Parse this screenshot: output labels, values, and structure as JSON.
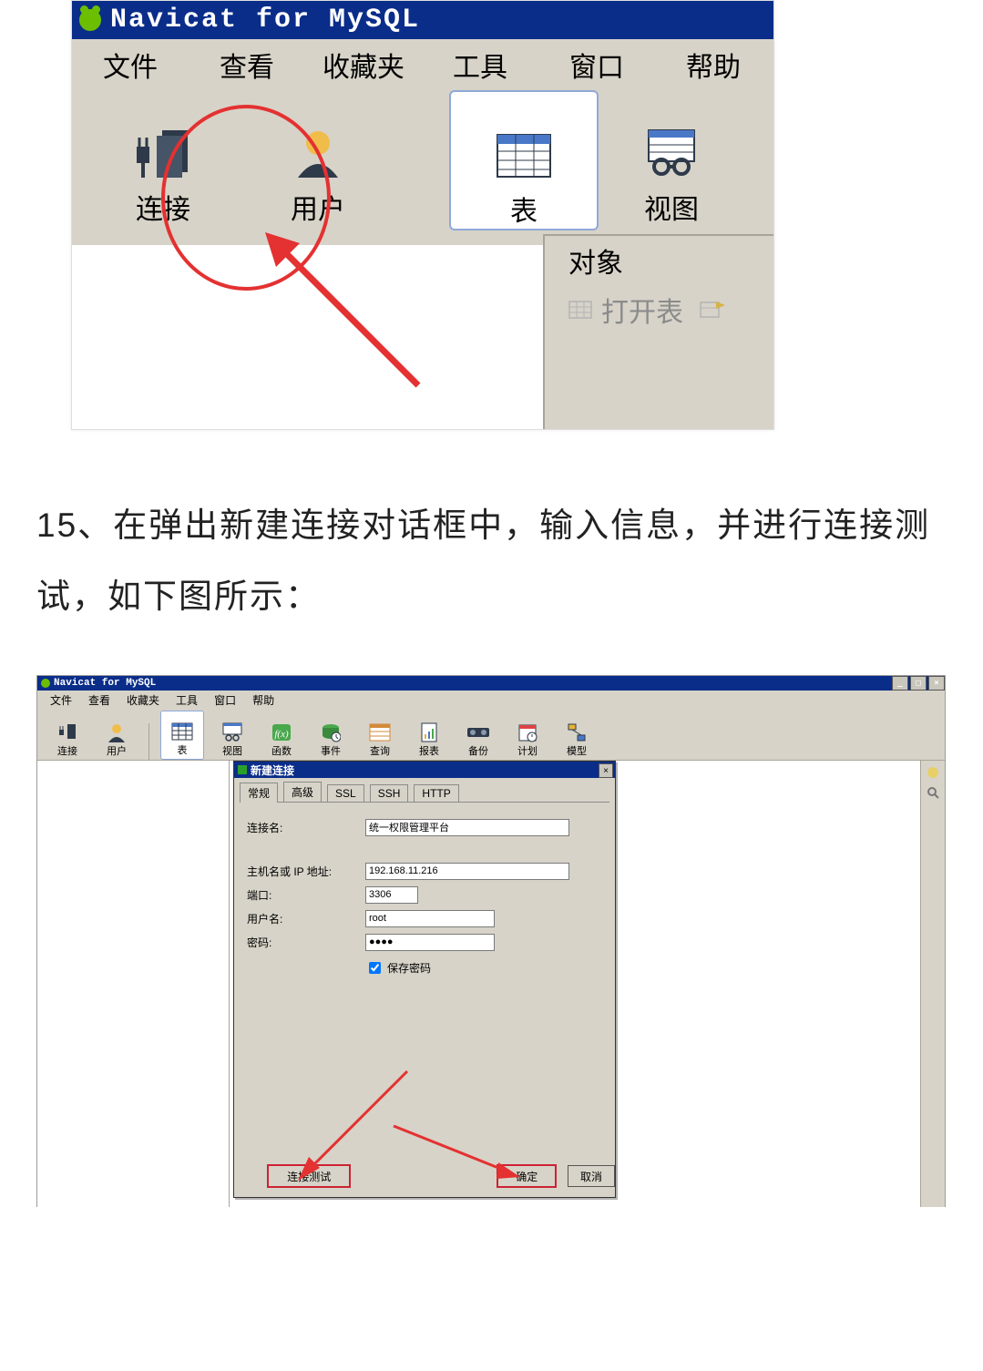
{
  "shot1": {
    "title": "Navicat for MySQL",
    "menu": [
      "文件",
      "查看",
      "收藏夹",
      "工具",
      "窗口",
      "帮助"
    ],
    "tools": {
      "connect": "连接",
      "user": "用户",
      "table": "表",
      "view": "视图"
    },
    "panel": {
      "object": "对象",
      "open_table": "打开表"
    }
  },
  "article": {
    "text": "15、在弹出新建连接对话框中，输入信息，并进行连接测试，如下图所示："
  },
  "shot2": {
    "title": "Navicat for MySQL",
    "menu": [
      "文件",
      "查看",
      "收藏夹",
      "工具",
      "窗口",
      "帮助"
    ],
    "tools": [
      "连接",
      "用户",
      "表",
      "视图",
      "函数",
      "事件",
      "查询",
      "报表",
      "备份",
      "计划",
      "模型"
    ],
    "dialog": {
      "title": "新建连接",
      "tabs": [
        "常规",
        "高级",
        "SSL",
        "SSH",
        "HTTP"
      ],
      "labels": {
        "conn_name": "连接名:",
        "host": "主机名或 IP 地址:",
        "port": "端口:",
        "user": "用户名:",
        "pass": "密码:"
      },
      "values": {
        "conn_name": "统一权限管理平台",
        "host": "192.168.11.216",
        "port": "3306",
        "user": "root",
        "pass": "●●●●"
      },
      "save_pass": "保存密码",
      "buttons": {
        "test": "连接测试",
        "ok": "确定",
        "cancel": "取消"
      }
    }
  }
}
